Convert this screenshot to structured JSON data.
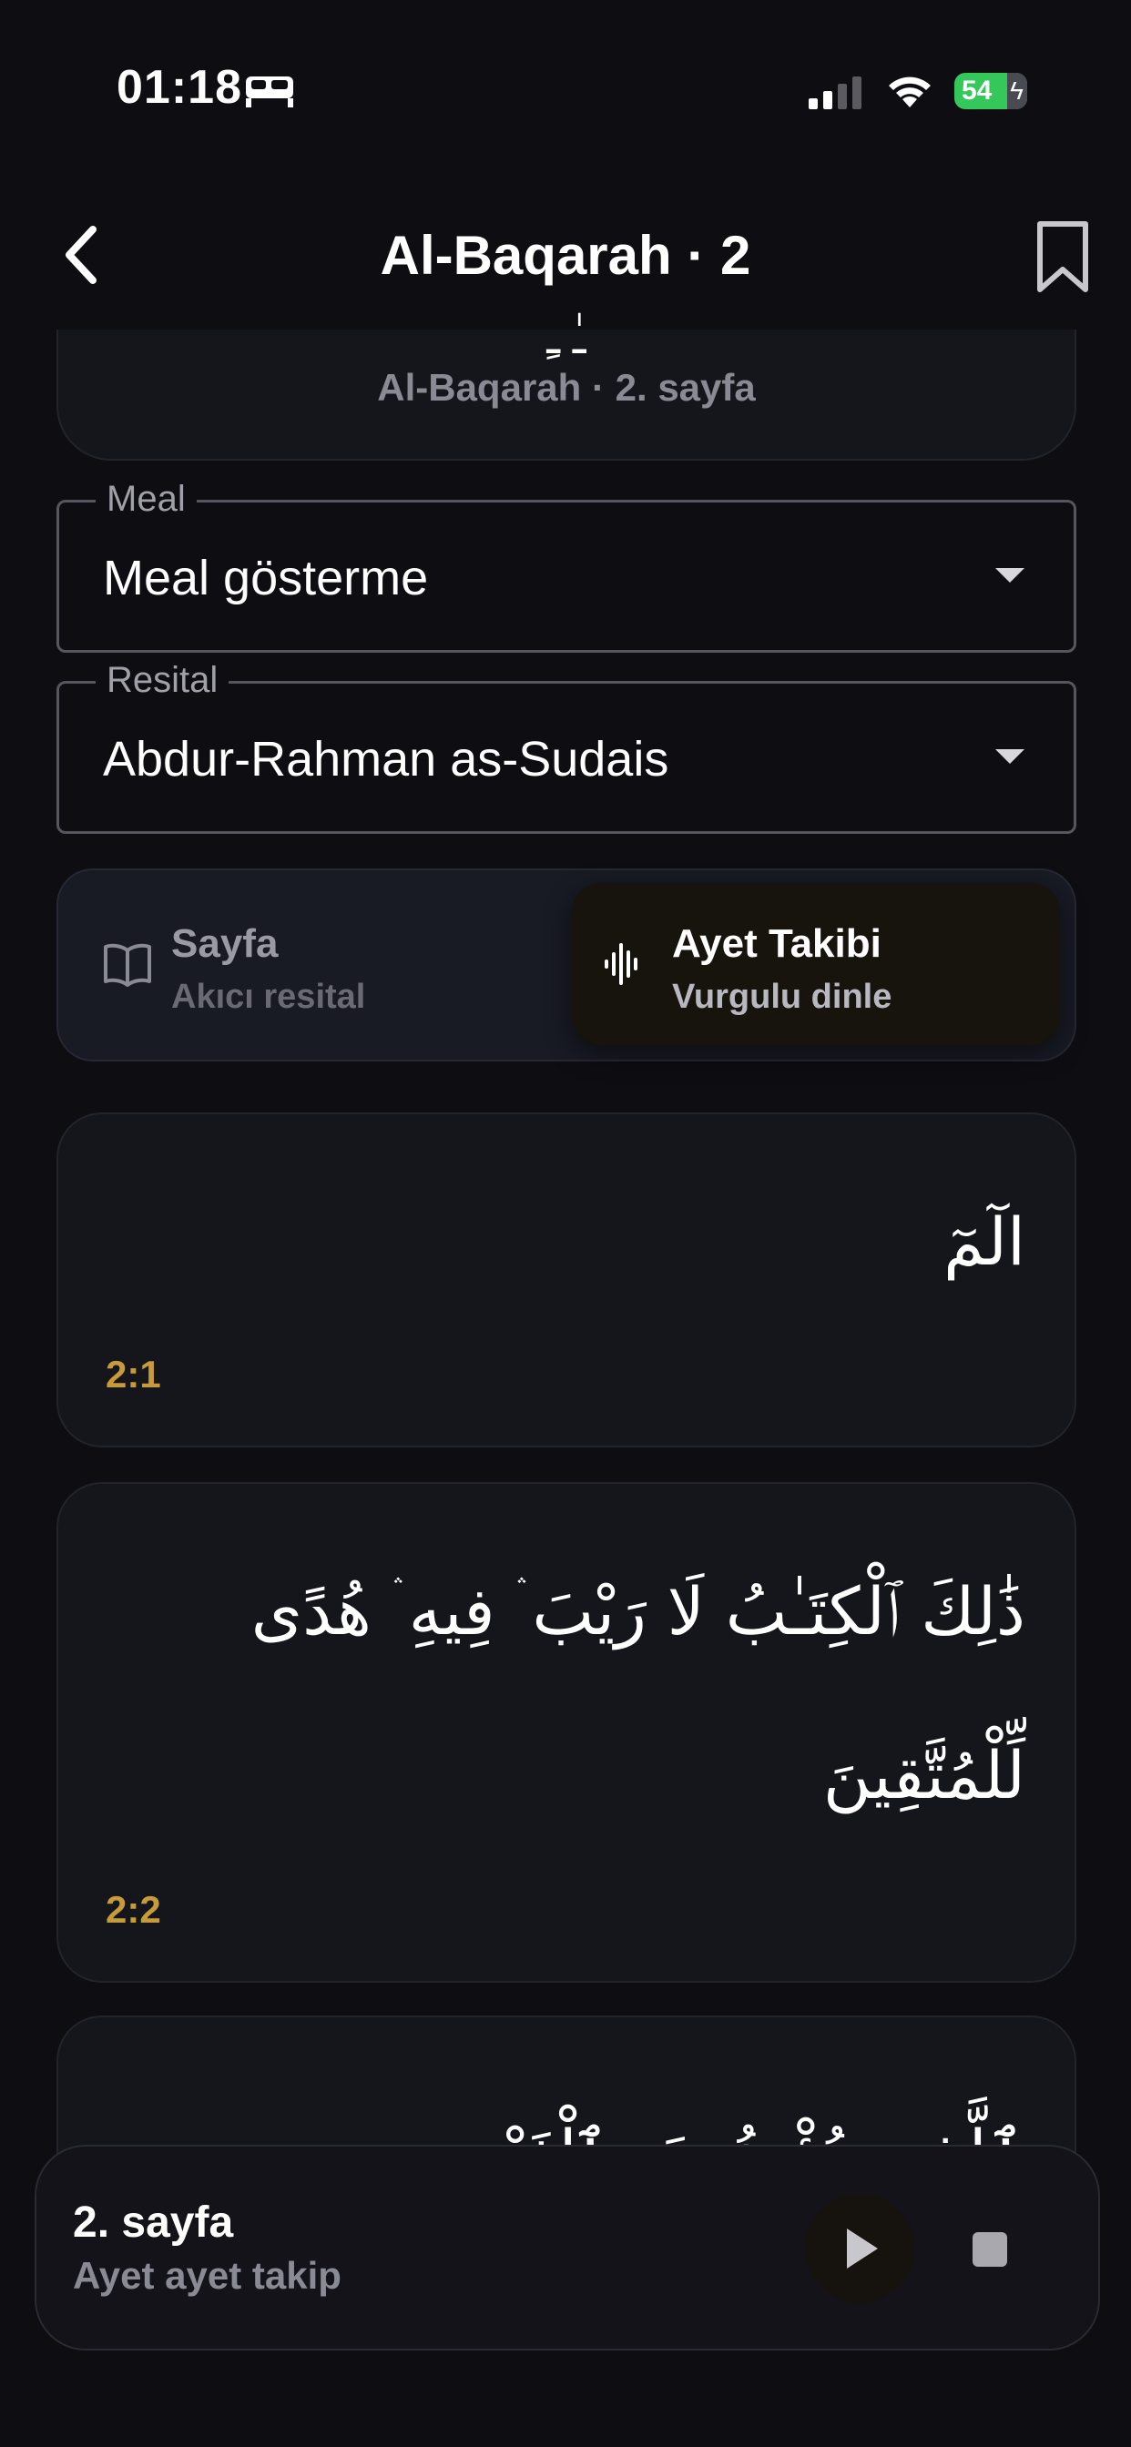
{
  "status": {
    "time": "01:18",
    "battery": "54"
  },
  "header": {
    "title": "Al-Baqarah · 2"
  },
  "top_card": {
    "subtitle": "Al-Baqarah · 2. sayfa"
  },
  "fields": {
    "meal": {
      "label": "Meal",
      "value": "Meal gösterme"
    },
    "resital": {
      "label": "Resital",
      "value": "Abdur-Rahman as-Sudais"
    }
  },
  "modes": {
    "page": {
      "title": "Sayfa",
      "subtitle": "Akıcı resital"
    },
    "ayet": {
      "title": "Ayet Takibi",
      "subtitle": "Vurgulu dinle"
    }
  },
  "verses": [
    {
      "arabic": "الٓمٓ",
      "ref": "2:1"
    },
    {
      "arabic": "ذَٰلِكَ ٱلْكِتَـٰبُ لَا رَيْبَ ۛ فِيهِ ۛ هُدًى لِّلْمُتَّقِينَ",
      "ref": "2:2"
    },
    {
      "arabic": "ٱلَّذِينَ يُؤْمِنُونَ بِٱلْغَيْبِ",
      "ref": ""
    }
  ],
  "player": {
    "title": "2. sayfa",
    "subtitle": "Ayet ayet takip"
  },
  "colors": {
    "accent_gold": "#c79a3a",
    "battery_green": "#34c759",
    "background": "#0d0d12"
  }
}
